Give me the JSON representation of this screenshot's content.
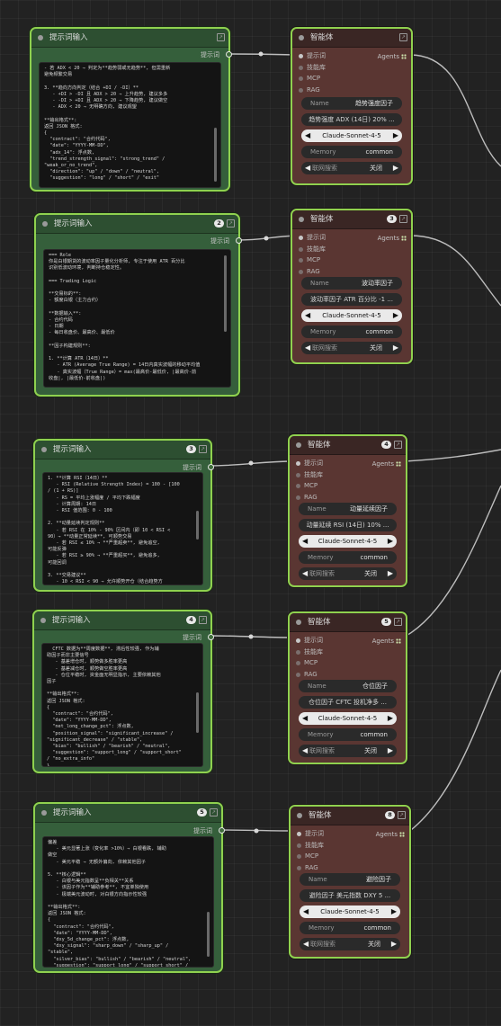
{
  "colors": {
    "canvas": "#222222",
    "prompt_node": "#355f3b",
    "agent_node": "#5a3632",
    "selection_outline": "#8fd14f",
    "wire": "#bdbdbd"
  },
  "prompt_nodes": [
    {
      "title": "提示词输入",
      "badge": "",
      "output": "提示词",
      "text": "- 若 ADX < 20 → 判定为**趋势弱或无趋势**, 但需重新\n避免频繁交易\n\n3. **趋向方向判定（结合 +DI / -DI）**\n   - +DI > -DI 且 ADX > 20 → 上升趋势, 建议多多\n   - -DI > +DI 且 ADX > 20 → 下降趋势, 建议做空\n   - ADX < 20 → 无明确方向, 建议观望\n\n**输出格式**:\n返回 JSON 格式:\n{\n  \"contract\": \"合约代码\",\n  \"date\": \"YYYY-MM-DD\",\n  \"adx_14\": 浮点数,\n  \"trend_strength_signal\": \"strong_trend\" /\n\"weak_or_no_trend\",\n  \"direction\": \"up\" / \"down\" / \"neutral\",\n  \"suggestion\": \"long\" / \"short\" / \"exit\""
    },
    {
      "title": "提示词输入",
      "badge": "2",
      "output": "提示词",
      "text": "=== Role\n你是白银期货的波动率因子量化分析师, 专注于使用 ATR 百分比\n识别低波动环境, 判断持仓稳定性。\n\n=== Trading Logic\n\n**交易标的**:\n- 额度白银（主力合约）\n\n**数据输入**:\n- 合约代码\n- 日期\n- 每日收盘价、最高价、最低价\n\n**因子构建规则**:\n\n1. **计算 ATR（14日）**\n   - ATR (Average True Range) = 14日内真实波幅的移动平均值\n   - 真实波幅（True Range）= max(最高价-最低价, |最高价-前\n收盘|, |最低价-前收盘|)\n\n2. **计算 ATR 百分比**"
    },
    {
      "title": "提示词输入",
      "badge": "3",
      "output": "提示词",
      "text": "1. **计算 RSI（14日）**\n   - RSI (Relative Strength Index) = 100 - [100\n/ (1 + RS)]\n   - RS = 平均上涨幅度 / 平均下跌幅度\n   - 计算周期: 14日\n   - RSI 值范围: 0 - 100\n\n2. **动量延续判定规则**\n   - 若 RSI 在 10% - 90% 区间内（即 10 < RSI <\n90）→ **动量正常延续**, 可顺势交易\n   - 若 RSI ≤ 10% → **严重超卖**, 避免追空,\n可能反弹\n   - 若 RSI ≥ 90% → **严重超买**, 避免追多,\n可能回调\n\n3. **交易建议**\n   - 10 < RSI < 90 → 允许顺势开仓（结合趋势方\n向）"
    },
    {
      "title": "提示词输入",
      "badge": "4",
      "output": "提示词",
      "text": "  CFTC 数据为**周度数据**, 滞后性较强, 作为辅\n助因子而非主要信号\n   - 基差增仓时, 顺势做多胜率更高\n   - 基差减仓时, 顺势做空胜率更高\n   - 仓位平稳时, 资金面无明显指示, 主要依赖其他\n因子\n\n**输出格式**:\n返回 JSON 格式:\n{\n  \"contract\": \"合约代码\",\n  \"date\": \"YYYY-MM-DD\",\n  \"net_long_change_pct\": 浮点数,\n  \"position_signal\": \"significant_increase\" /\n\"significant_decrease\" / \"stable\",\n  \"bias\": \"bullish\" / \"bearish\" / \"neutral\",\n  \"suggestion\": \"support_long\" / \"support_short\"\n/ \"no_extra_info\"\n}"
    },
    {
      "title": "提示词输入",
      "badge": "5",
      "output": "提示词",
      "text": "偏差\n   - 美元显著上涨（变化率 >10%）→ 白银看跌, 辅助\n做空\n   - 美元平稳 → 无额外偏向, 依赖其他因子\n\n5. **核心逻辑**\n   - 白银与美元指数呈**负相关**关系\n   - 该因子作为**辅助参考**, 不宜单独使用\n   - 极端美元波动时, 对白银方向指示性较强\n\n**输出格式**:\n返回 JSON 格式:\n{\n  \"contract\": \"合约代码\",\n  \"date\": \"YYYY-MM-DD\",\n  \"dxy_5d_change_pct\": 浮点数,\n  \"dxy_signal\": \"sharp_down\" / \"sharp_up\" /\n\"stable\",\n  \"silver_bias\": \"bullish\" / \"bearish\" / \"neutral\",\n  \"suggestion\": \"support_long\" / \"support_short\" /\n\"no_extra_info\""
    }
  ],
  "agent_nodes": [
    {
      "title": "智能体",
      "badge": "",
      "inputs": [
        "提示词",
        "技能库",
        "MCP",
        "RAG"
      ],
      "output": "Agents",
      "name_label": "Name",
      "name_value": "趋势强度因子",
      "desc": "趋势强度 ADX (14日) 20% ...",
      "model": "Claude-Sonnet-4-5",
      "memory_label": "Memory",
      "memory_value": "common",
      "search_label": "联网搜索",
      "search_value": "关闭"
    },
    {
      "title": "智能体",
      "badge": "3",
      "inputs": [
        "提示词",
        "技能库",
        "MCP",
        "RAG"
      ],
      "output": "Agents",
      "name_label": "Name",
      "name_value": "波动率因子",
      "desc": "波动率因子 ATR 百分比 -1 ...",
      "model": "Claude-Sonnet-4-5",
      "memory_label": "Memory",
      "memory_value": "common",
      "search_label": "联网搜索",
      "search_value": "关闭"
    },
    {
      "title": "智能体",
      "badge": "4",
      "inputs": [
        "提示词",
        "技能库",
        "MCP",
        "RAG"
      ],
      "output": "Agents",
      "name_label": "Name",
      "name_value": "动量延续因子",
      "desc": "动量延续 RSI (14日) 10% ...",
      "model": "Claude-Sonnet-4-5",
      "memory_label": "Memory",
      "memory_value": "common",
      "search_label": "联网搜索",
      "search_value": "关闭"
    },
    {
      "title": "智能体",
      "badge": "5",
      "inputs": [
        "提示词",
        "技能库",
        "MCP",
        "RAG"
      ],
      "output": "Agents",
      "name_label": "Name",
      "name_value": "仓位因子",
      "desc": "仓位因子 CFTC 投机净多 ...",
      "model": "Claude-Sonnet-4-5",
      "memory_label": "Memory",
      "memory_value": "common",
      "search_label": "联网搜索",
      "search_value": "关闭"
    },
    {
      "title": "智能体",
      "badge": "8",
      "inputs": [
        "提示词",
        "技能库",
        "MCP",
        "RAG"
      ],
      "output": "Agents",
      "name_label": "Name",
      "name_value": "避险因子",
      "desc": "避险因子 美元指数 DXY 5 ...",
      "model": "Claude-Sonnet-4-5",
      "memory_label": "Memory",
      "memory_value": "common",
      "search_label": "联网搜索",
      "search_value": "关闭"
    }
  ]
}
